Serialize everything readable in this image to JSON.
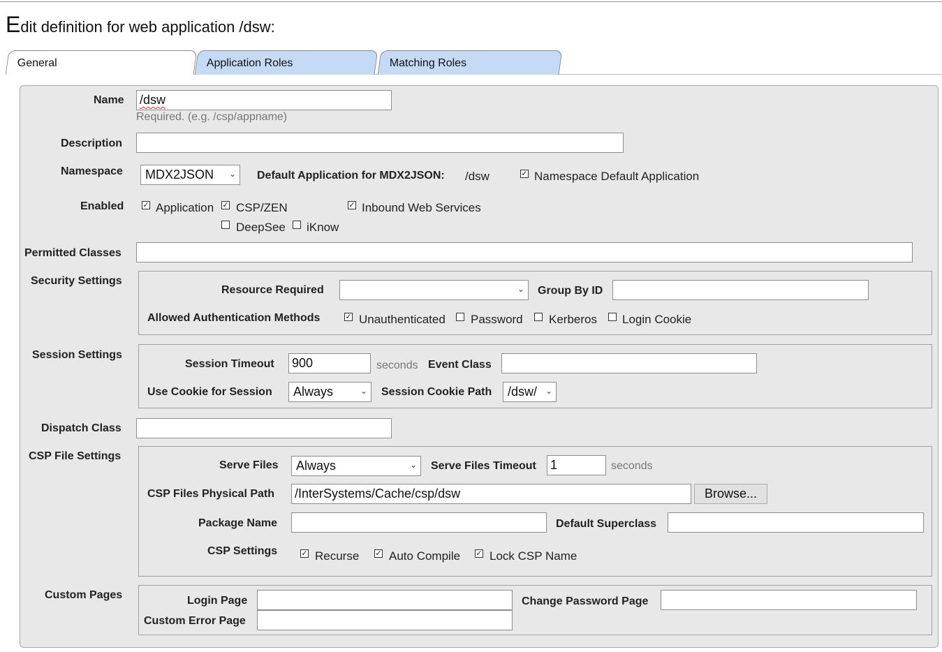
{
  "page": {
    "title_first_letter": "E",
    "title_rest": "dit definition for web application /dsw:"
  },
  "tabs": [
    {
      "label": "General",
      "active": true
    },
    {
      "label": "Application Roles",
      "active": false
    },
    {
      "label": "Matching Roles",
      "active": false
    }
  ],
  "form": {
    "name": {
      "label": "Name",
      "value": "/dsw",
      "hint": "Required. (e.g. /csp/appname)"
    },
    "description": {
      "label": "Description",
      "value": ""
    },
    "namespace": {
      "label": "Namespace",
      "value": "MDX2JSON",
      "default_app_label": "Default Application for MDX2JSON:",
      "default_app_value": "/dsw",
      "ns_default_checkbox": {
        "label": "Namespace Default Application",
        "checked": true
      }
    },
    "enabled": {
      "label": "Enabled",
      "options": [
        {
          "label": "Application",
          "checked": true
        },
        {
          "label": "CSP/ZEN",
          "checked": true
        },
        {
          "label": "Inbound Web Services",
          "checked": true
        },
        {
          "label": "DeepSee",
          "checked": false
        },
        {
          "label": "iKnow",
          "checked": false
        }
      ]
    },
    "permitted_classes": {
      "label": "Permitted Classes",
      "value": ""
    },
    "security": {
      "label": "Security Settings",
      "resource_required_label": "Resource Required",
      "resource_required_value": "",
      "group_by_id_label": "Group By ID",
      "group_by_id_value": "",
      "auth_methods_label": "Allowed Authentication Methods",
      "auth_methods": [
        {
          "label": "Unauthenticated",
          "checked": true
        },
        {
          "label": "Password",
          "checked": false
        },
        {
          "label": "Kerberos",
          "checked": false
        },
        {
          "label": "Login Cookie",
          "checked": false
        }
      ]
    },
    "session": {
      "label": "Session Settings",
      "timeout_label": "Session Timeout",
      "timeout_value": "900",
      "timeout_unit": "seconds",
      "event_class_label": "Event Class",
      "event_class_value": "",
      "use_cookie_label": "Use Cookie for Session",
      "use_cookie_value": "Always",
      "cookie_path_label": "Session Cookie Path",
      "cookie_path_value": "/dsw/"
    },
    "dispatch_class": {
      "label": "Dispatch Class",
      "value": ""
    },
    "csp_files": {
      "label": "CSP File Settings",
      "serve_files_label": "Serve Files",
      "serve_files_value": "Always",
      "serve_timeout_label": "Serve Files Timeout",
      "serve_timeout_value": "1",
      "serve_timeout_unit": "seconds",
      "physical_path_label": "CSP Files Physical Path",
      "physical_path_value": "/InterSystems/Cache/csp/dsw",
      "browse_label": "Browse...",
      "package_name_label": "Package Name",
      "package_name_value": "",
      "default_superclass_label": "Default Superclass",
      "default_superclass_value": "",
      "csp_settings_label": "CSP Settings",
      "csp_settings": [
        {
          "label": "Recurse",
          "checked": true
        },
        {
          "label": "Auto Compile",
          "checked": true
        },
        {
          "label": "Lock CSP Name",
          "checked": true
        }
      ]
    },
    "custom_pages": {
      "label": "Custom Pages",
      "login_page_label": "Login Page",
      "login_page_value": "",
      "change_pw_label": "Change Password Page",
      "change_pw_value": "",
      "error_page_label": "Custom Error Page",
      "error_page_value": ""
    },
    "check_glyph": "✓",
    "chevron_glyph": "⌄"
  }
}
